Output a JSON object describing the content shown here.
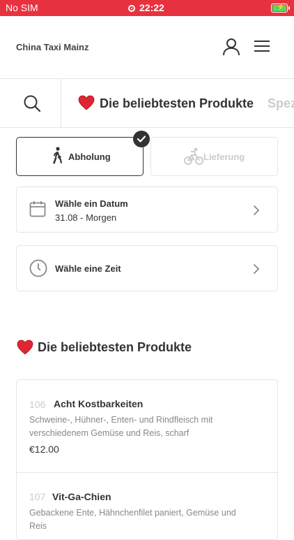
{
  "status_bar": {
    "carrier": "No SIM",
    "time": "22:22"
  },
  "header": {
    "title": "China Taxi Mainz"
  },
  "category_bar": {
    "active": "Die beliebtesten Produkte",
    "next": "Spez"
  },
  "order_mode": {
    "pickup_label": "Abholung",
    "delivery_label": "Lieferung",
    "selected": "pickup"
  },
  "date_row": {
    "title": "Wähle ein Datum",
    "value": "31.08 - Morgen"
  },
  "time_row": {
    "title": "Wähle eine Zeit"
  },
  "section": {
    "title": "Die beliebtesten Produkte"
  },
  "products": [
    {
      "number": "106",
      "name": "Acht Kostbarkeiten",
      "description": "Schweine-, Hühner-, Enten- und Rindfleisch mit verschiedenem Gemüse und Reis, scharf",
      "price": "€12.00"
    },
    {
      "number": "107",
      "name": "Vit-Ga-Chien",
      "description": "Gebackene Ente, Hähnchenfilet paniert, Gemüse und Reis"
    }
  ],
  "colors": {
    "accent": "#e8313f",
    "text": "#333333",
    "muted": "#cccccc",
    "border": "#e5e5e5",
    "battery": "#4cd964"
  },
  "icons": [
    "user-icon",
    "menu-icon",
    "search-icon",
    "heart-icon",
    "walking-icon",
    "bicycle-icon",
    "check-icon",
    "calendar-icon",
    "clock-icon",
    "chevron-right-icon"
  ]
}
